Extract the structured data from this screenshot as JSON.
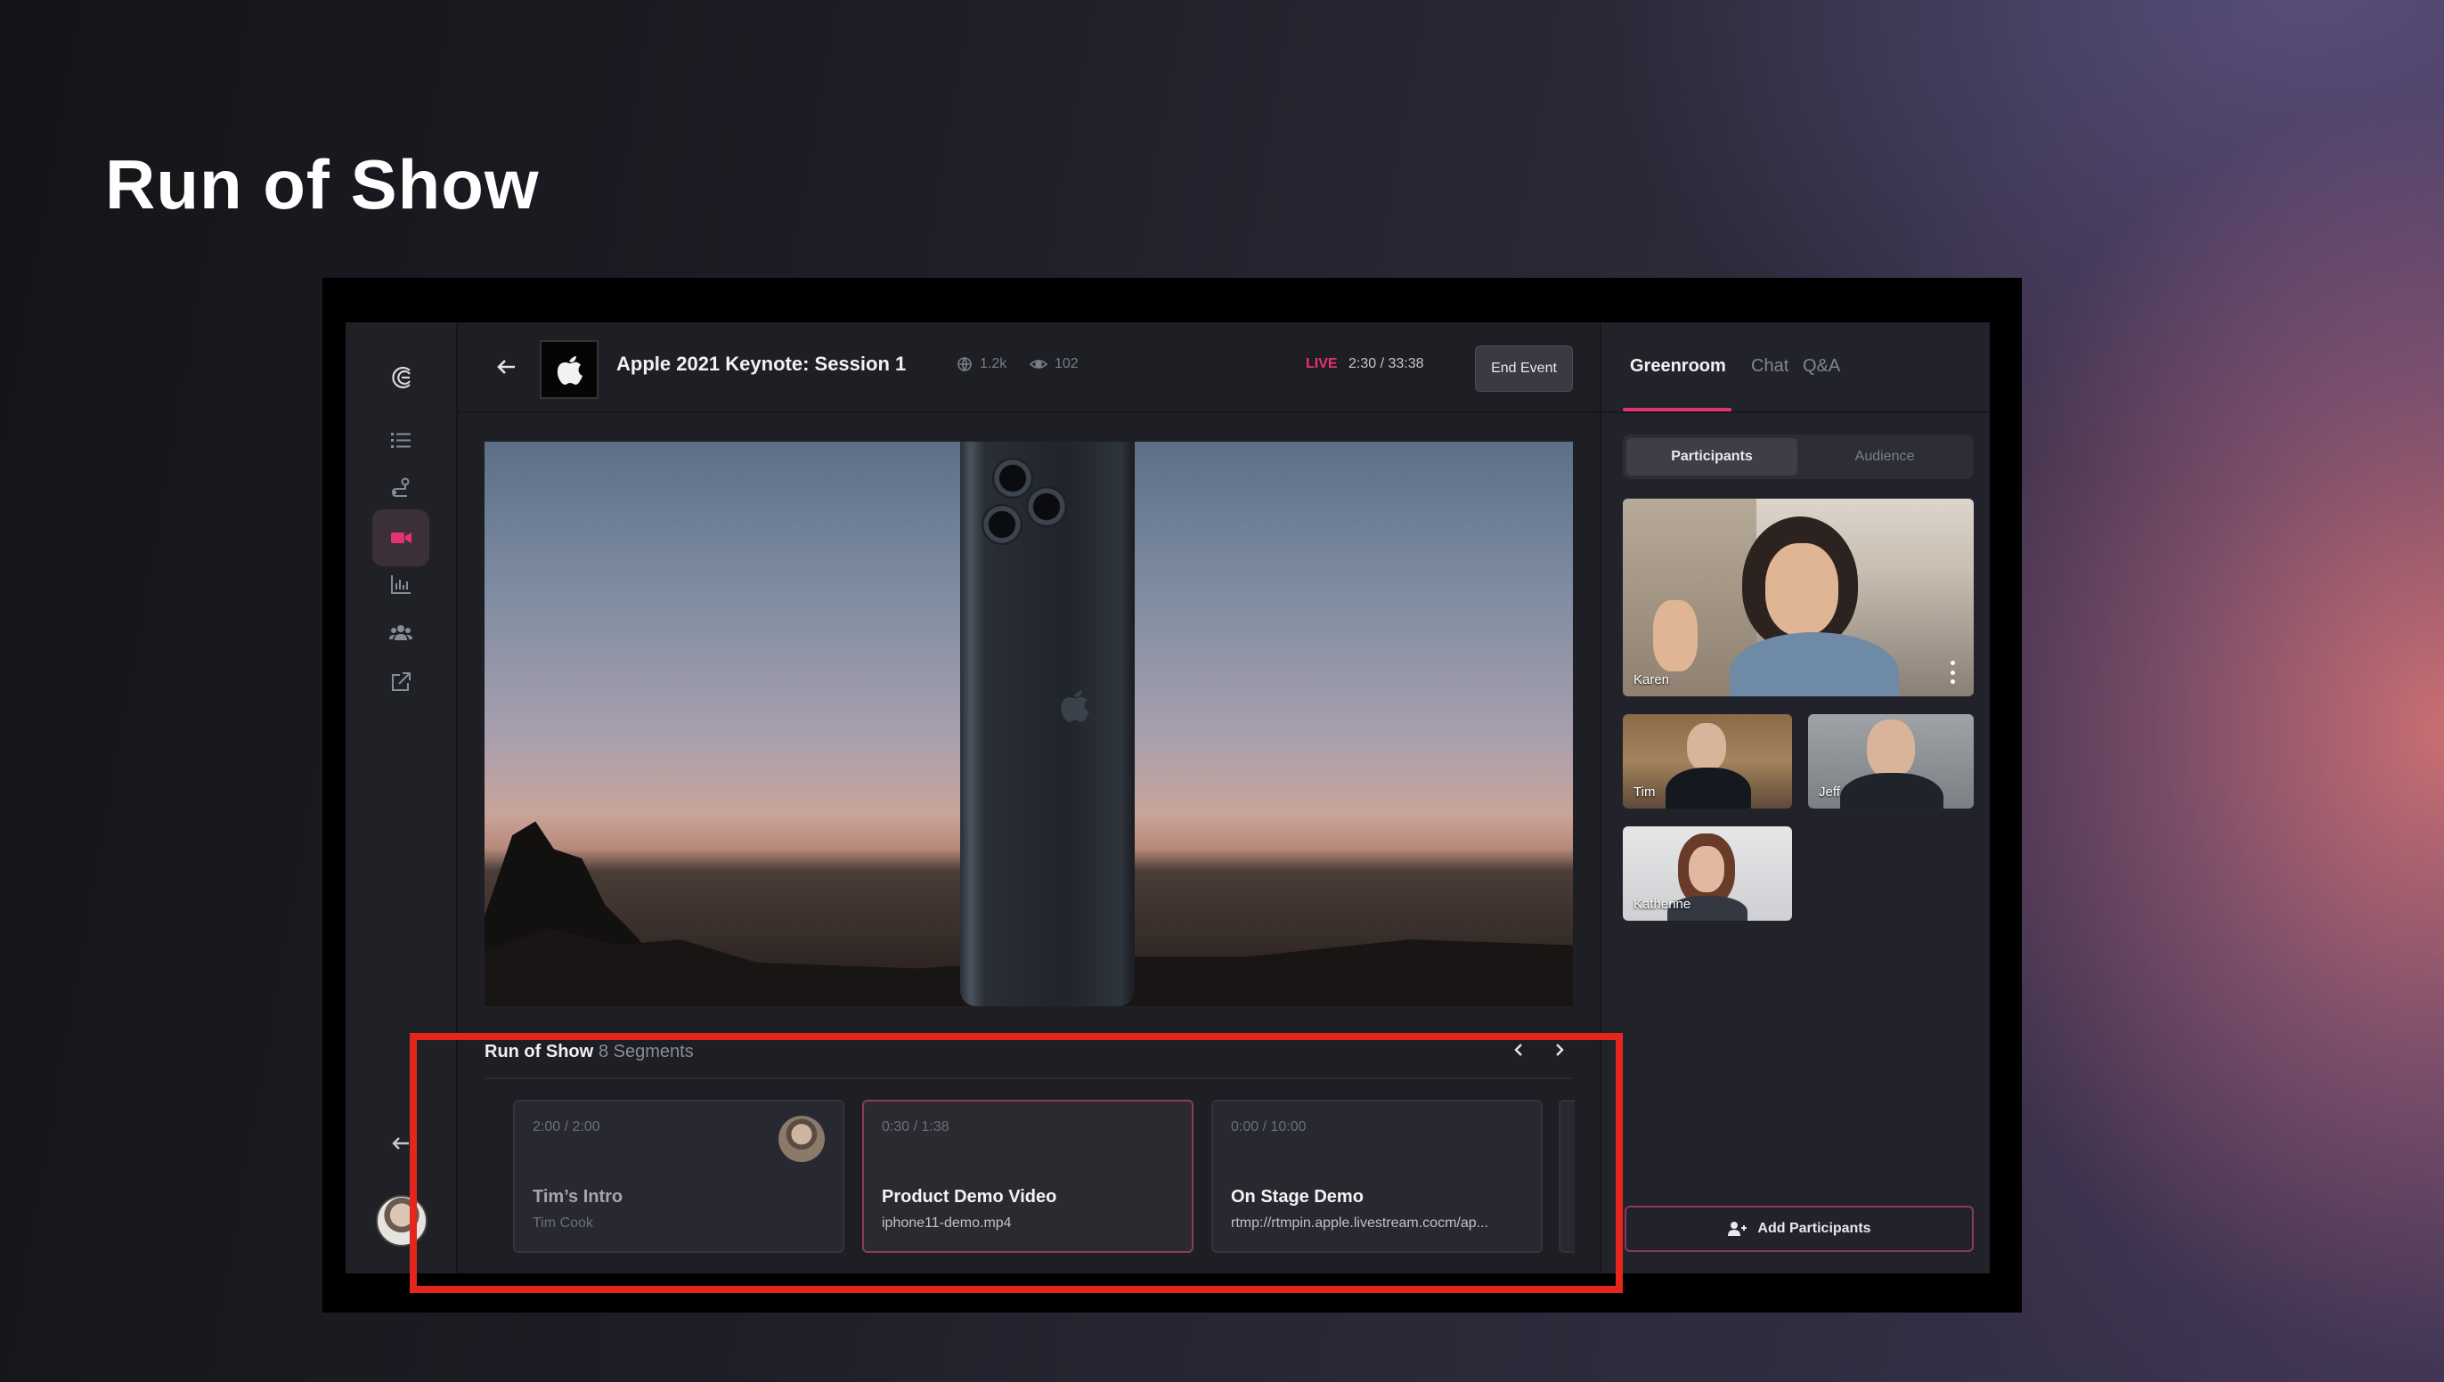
{
  "page": {
    "title": "Run of Show"
  },
  "header": {
    "event_title": "Apple 2021 Keynote: Session 1",
    "stat_globe": "1.2k",
    "stat_views": "102",
    "live_label": "LIVE",
    "live_time": "2:30 / 33:38",
    "end_event_label": "End Event"
  },
  "run_of_show": {
    "title": "Run of Show",
    "count": "8 Segments",
    "segments": [
      {
        "time": "2:00 / 2:00",
        "title": "Tim’s Intro",
        "subtitle": "Tim Cook"
      },
      {
        "time": "0:30 / 1:38",
        "title": "Product Demo Video",
        "subtitle": "iphone11-demo.mp4"
      },
      {
        "time": "0:00 / 10:00",
        "title": "On Stage Demo",
        "subtitle": "rtmp://rtmpin.apple.livestream.cocm/ap..."
      }
    ]
  },
  "panel": {
    "tabs": [
      "Greenroom",
      "Chat",
      "Q&A"
    ],
    "active_tab": "Greenroom",
    "toggle": [
      "Participants",
      "Audience"
    ],
    "participants": [
      "Karen",
      "Tim",
      "Jeff",
      "Katherine"
    ],
    "add_participants_label": "Add Participants"
  },
  "colors": {
    "accent": "#e6326e",
    "highlight": "#e4261c",
    "background": "#1e1f25"
  },
  "icons": {
    "logo": "logo-icon",
    "sidebar": [
      "list-icon",
      "route-icon",
      "video-camera-icon",
      "bar-chart-icon",
      "people-icon",
      "external-link-icon"
    ],
    "collapse": "arrow-left-icon"
  }
}
